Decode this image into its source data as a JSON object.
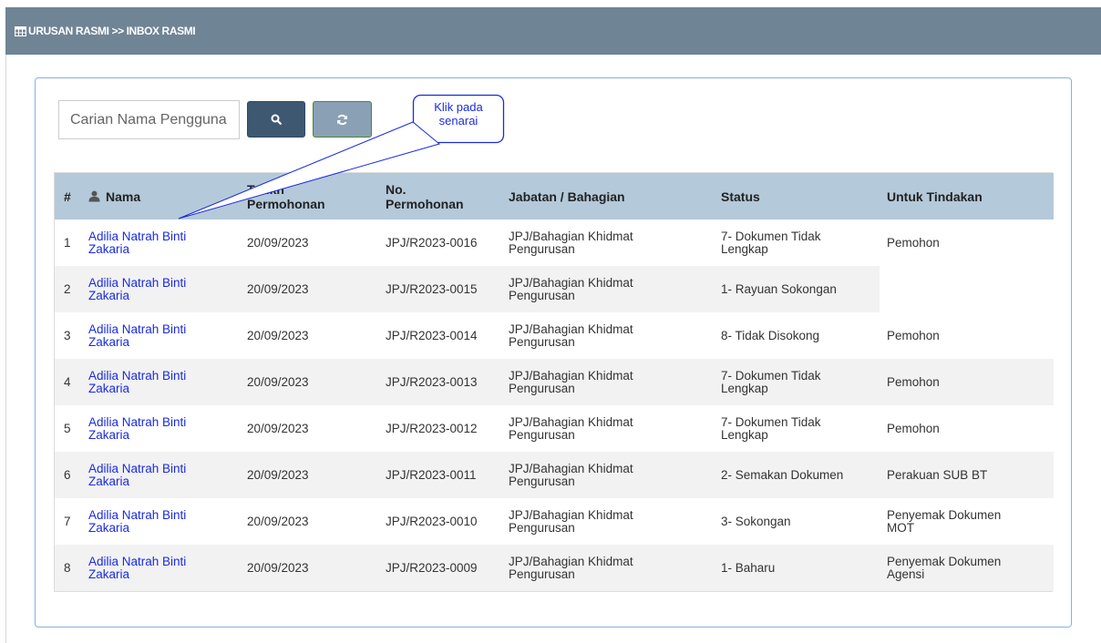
{
  "header": {
    "breadcrumb": "URUSAN RASMI >> INBOX RASMI",
    "icon": "table-icon",
    "background": "#6f8495"
  },
  "search": {
    "placeholder": "Carian Nama Pengguna",
    "value": "",
    "search_icon": "search-icon",
    "refresh_icon": "refresh-icon"
  },
  "callout": {
    "line1": "Klik pada",
    "line2": "senarai"
  },
  "table": {
    "headers": {
      "num": "#",
      "nama": "Nama",
      "tarikh_1": "Tarikh",
      "tarikh_2": "Permohonan",
      "no_1": "No.",
      "no_2": "Permohonan",
      "jabatan": "Jabatan / Bahagian",
      "status": "Status",
      "tindakan": "Untuk Tindakan"
    },
    "rows": [
      {
        "num": "1",
        "name1": "Adilia Natrah Binti",
        "name2": "Zakaria",
        "date": "20/09/2023",
        "no": "JPJ/R2023-0016",
        "jab1": "JPJ/Bahagian Khidmat",
        "jab2": "Pengurusan",
        "status1": "7- Dokumen Tidak",
        "status2": "Lengkap",
        "act1": "Pemohon",
        "act2": ""
      },
      {
        "num": "2",
        "name1": "Adilia Natrah Binti",
        "name2": "Zakaria",
        "date": "20/09/2023",
        "no": "JPJ/R2023-0015",
        "jab1": "JPJ/Bahagian Khidmat",
        "jab2": "Pengurusan",
        "status1": "1- Rayuan Sokongan",
        "status2": "",
        "act1": "",
        "act2": ""
      },
      {
        "num": "3",
        "name1": "Adilia Natrah Binti",
        "name2": "Zakaria",
        "date": "20/09/2023",
        "no": "JPJ/R2023-0014",
        "jab1": "JPJ/Bahagian Khidmat",
        "jab2": "Pengurusan",
        "status1": "8- Tidak Disokong",
        "status2": "",
        "act1": "Pemohon",
        "act2": ""
      },
      {
        "num": "4",
        "name1": "Adilia Natrah Binti",
        "name2": "Zakaria",
        "date": "20/09/2023",
        "no": "JPJ/R2023-0013",
        "jab1": "JPJ/Bahagian Khidmat",
        "jab2": "Pengurusan",
        "status1": "7- Dokumen Tidak",
        "status2": "Lengkap",
        "act1": "Pemohon",
        "act2": ""
      },
      {
        "num": "5",
        "name1": "Adilia Natrah Binti",
        "name2": "Zakaria",
        "date": "20/09/2023",
        "no": "JPJ/R2023-0012",
        "jab1": "JPJ/Bahagian Khidmat",
        "jab2": "Pengurusan",
        "status1": "7- Dokumen Tidak",
        "status2": "Lengkap",
        "act1": "Pemohon",
        "act2": ""
      },
      {
        "num": "6",
        "name1": "Adilia Natrah Binti",
        "name2": "Zakaria",
        "date": "20/09/2023",
        "no": "JPJ/R2023-0011",
        "jab1": "JPJ/Bahagian Khidmat",
        "jab2": "Pengurusan",
        "status1": "2- Semakan Dokumen",
        "status2": "",
        "act1": "Perakuan SUB BT",
        "act2": ""
      },
      {
        "num": "7",
        "name1": "Adilia Natrah Binti",
        "name2": "Zakaria",
        "date": "20/09/2023",
        "no": "JPJ/R2023-0010",
        "jab1": "JPJ/Bahagian Khidmat",
        "jab2": "Pengurusan",
        "status1": "3- Sokongan",
        "status2": "",
        "act1": "Penyemak Dokumen",
        "act2": "MOT"
      },
      {
        "num": "8",
        "name1": "Adilia Natrah Binti",
        "name2": "Zakaria",
        "date": "20/09/2023",
        "no": "JPJ/R2023-0009",
        "jab1": "JPJ/Bahagian Khidmat",
        "jab2": "Pengurusan",
        "status1": "1- Baharu",
        "status2": "",
        "act1": "Penyemak Dokumen",
        "act2": "Agensi"
      }
    ]
  },
  "colors": {
    "accent": "#3e5872",
    "link": "#1a2be0",
    "table_header": "#b4c9d9",
    "panel_border": "#8ab0dd"
  }
}
